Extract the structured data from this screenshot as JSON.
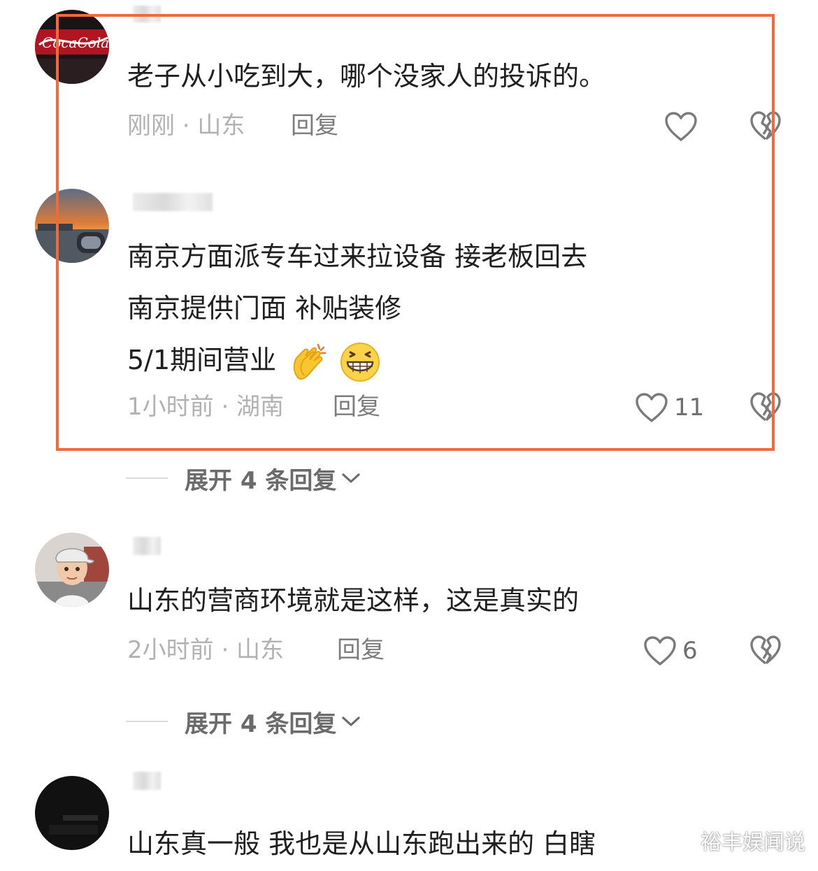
{
  "comments": [
    {
      "content_lines": [
        "老子从小吃到大，哪个没家人的投诉的。"
      ],
      "meta": "刚刚 · 山东",
      "reply_label": "回复",
      "like_count": "",
      "avatar_icon": "coca-cola-logo-avatar"
    },
    {
      "content_lines": [
        "南京方面派专车过来拉设备  接老板回去",
        "南京提供门面  补贴装修",
        "5/1期间营业"
      ],
      "meta": "1小时前 · 湖南",
      "reply_label": "回复",
      "like_count": "11",
      "emojis": [
        "clapping-hands-emoji",
        "grinning-face-emoji"
      ],
      "avatar_icon": "sunset-river-avatar",
      "expand_label": "展开 4 条回复"
    },
    {
      "content_lines": [
        "山东的营商环境就是这样，这是真实的"
      ],
      "meta": "2小时前 · 山东",
      "reply_label": "回复",
      "like_count": "6",
      "avatar_icon": "cartoon-boy-avatar",
      "expand_label": "展开 4 条回复"
    },
    {
      "content_lines": [
        "山东真一般  我也是从山东跑出来的  白瞎"
      ],
      "avatar_icon": "dark-photo-avatar"
    }
  ],
  "watermark": "裕丰娱闻说",
  "colors": {
    "highlight_border": "#ef6a3c",
    "meta_text": "#b2b2b2",
    "reply_text": "#7c7c7c"
  }
}
